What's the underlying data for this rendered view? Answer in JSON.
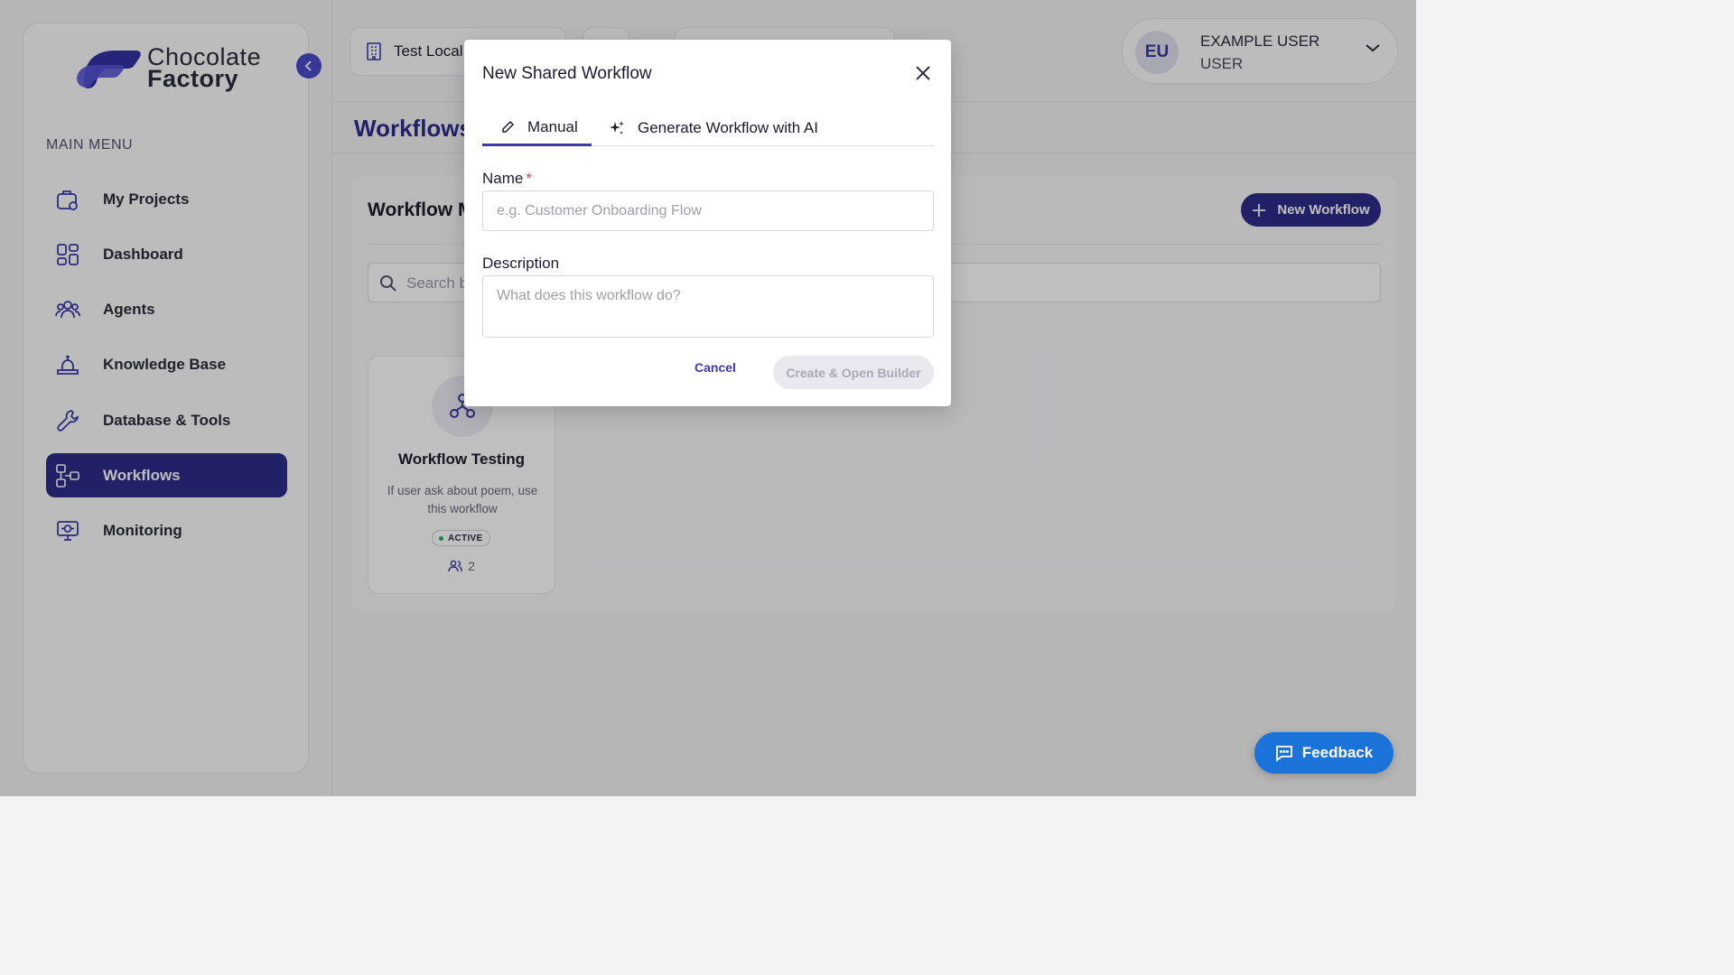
{
  "brand": {
    "line1": "Chocolate",
    "line2": "Factory"
  },
  "sidebar": {
    "menu_title": "MAIN MENU",
    "items": [
      {
        "label": "My Projects",
        "icon": "projects-icon",
        "active": false
      },
      {
        "label": "Dashboard",
        "icon": "dashboard-icon",
        "active": false
      },
      {
        "label": "Agents",
        "icon": "agents-icon",
        "active": false
      },
      {
        "label": "Knowledge Base",
        "icon": "knowledge-base-icon",
        "active": false
      },
      {
        "label": "Database & Tools",
        "icon": "wrench-icon",
        "active": false
      },
      {
        "label": "Workflows",
        "icon": "workflows-icon",
        "active": true
      },
      {
        "label": "Monitoring",
        "icon": "monitor-icon",
        "active": false
      }
    ]
  },
  "topbar": {
    "workspace_label": "Test Local",
    "user": {
      "initials": "EU",
      "name": "EXAMPLE USER",
      "role": "USER"
    }
  },
  "page": {
    "title": "Workflows",
    "panel_title": "Workflow M",
    "new_workflow_label": "New Workflow",
    "search_placeholder": "Search b"
  },
  "cards": [
    {
      "title": "Workflow Testing",
      "description": "If user ask about poem, use this workflow",
      "status": "ACTIVE",
      "members": "2"
    }
  ],
  "modal": {
    "title": "New Shared Workflow",
    "tabs": {
      "manual": "Manual",
      "ai": "Generate Workflow with AI"
    },
    "name_label": "Name",
    "required_mark": "*",
    "name_placeholder": "e.g. Customer Onboarding Flow",
    "description_label": "Description",
    "description_placeholder": "What does this workflow do?",
    "cancel_label": "Cancel",
    "create_label": "Create & Open Builder"
  },
  "feedback_label": "Feedback",
  "colors": {
    "accent": "#2e2c8a",
    "feedback": "#1a73d9",
    "active_dot": "#2ab05a",
    "required": "#e0443e"
  }
}
